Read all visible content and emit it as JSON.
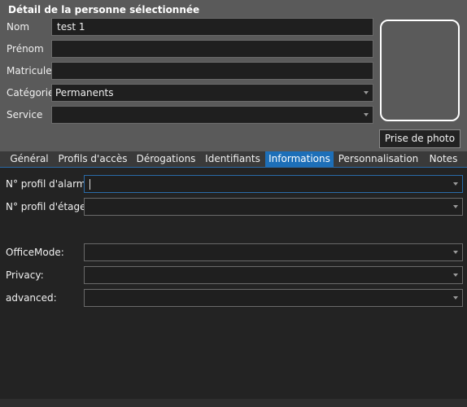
{
  "detail": {
    "title": "Détail de la personne sélectionnée",
    "nom_label": "Nom",
    "nom_value": "test 1",
    "prenom_label": "Prénom",
    "prenom_value": "",
    "matricule_label": "Matricule",
    "matricule_value": "",
    "categorie_label": "Catégorie",
    "categorie_value": "Permanents",
    "service_label": "Service",
    "service_value": "",
    "photo_button": "Prise de photo"
  },
  "tabs": [
    {
      "label": "Général",
      "active": false
    },
    {
      "label": "Profils d'accès",
      "active": false
    },
    {
      "label": "Dérogations",
      "active": false
    },
    {
      "label": "Identifiants",
      "active": false
    },
    {
      "label": "Informations",
      "active": true
    },
    {
      "label": "Personnalisation",
      "active": false
    },
    {
      "label": "Notes",
      "active": false
    }
  ],
  "informations": {
    "alarme_label": "N° profil d'alarme:",
    "alarme_value": "",
    "etage_label": "N° profil d'étage:",
    "etage_value": "",
    "officemode_label": "OfficeMode:",
    "officemode_value": "",
    "privacy_label": "Privacy:",
    "privacy_value": "",
    "advanced_label": "advanced:",
    "advanced_value": ""
  },
  "colors": {
    "top_panel_bg": "#5a5a5a",
    "content_bg": "#232323",
    "field_bg": "#1f1f1f",
    "active_tab": "#1d6fb8"
  }
}
